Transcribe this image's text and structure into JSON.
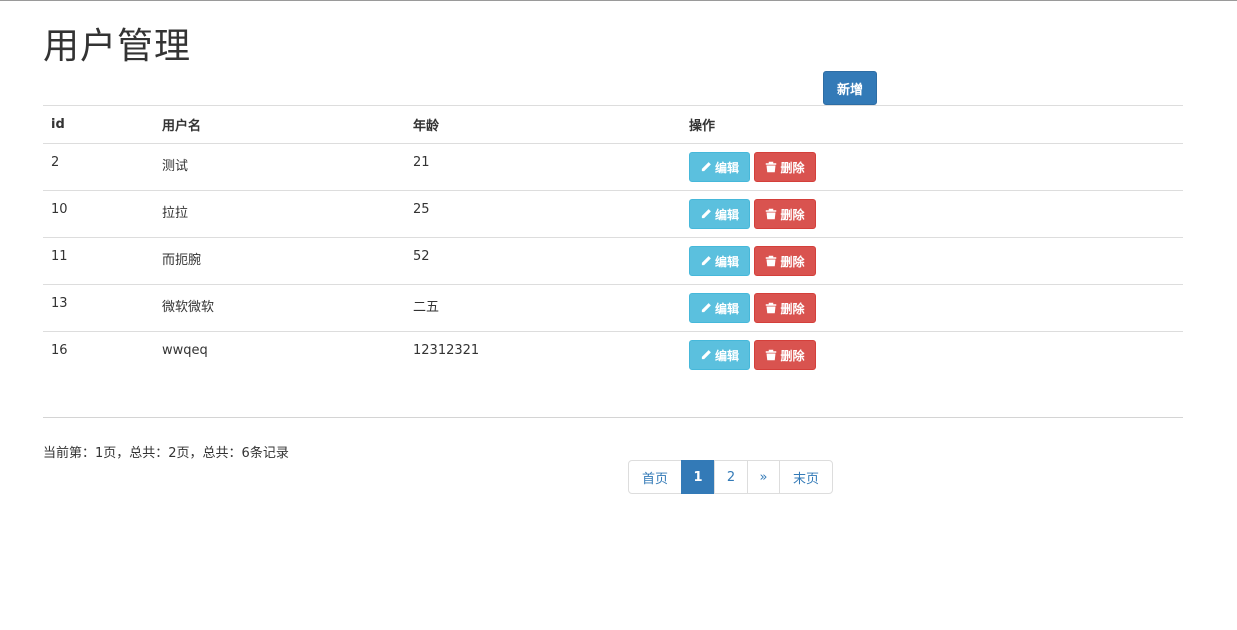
{
  "page": {
    "title": "用户管理"
  },
  "toolbar": {
    "add_label": "新增"
  },
  "table": {
    "headers": {
      "id": "id",
      "name": "用户名",
      "age": "年龄",
      "ops": "操作"
    },
    "rows": [
      {
        "id": "2",
        "name": "测试",
        "age": "21"
      },
      {
        "id": "10",
        "name": "拉拉",
        "age": "25"
      },
      {
        "id": "11",
        "name": "而扼腕",
        "age": "52"
      },
      {
        "id": "13",
        "name": "微软微软",
        "age": "二五"
      },
      {
        "id": "16",
        "name": "wwqeq",
        "age": "12312321"
      }
    ],
    "edit_label": "编辑",
    "delete_label": "删除"
  },
  "pagination": {
    "info": "当前第：1页，总共：2页，总共：6条记录",
    "first_label": "首页",
    "pages": [
      "1",
      "2"
    ],
    "current": "1",
    "next_label": "»",
    "last_label": "末页"
  },
  "colors": {
    "primary": "#337ab7",
    "info": "#5bc0de",
    "danger": "#d9534f"
  },
  "icons": {
    "edit": "pencil-icon",
    "delete": "trash-icon"
  }
}
